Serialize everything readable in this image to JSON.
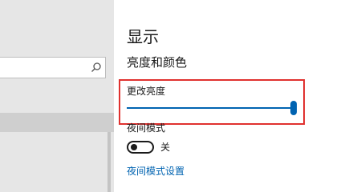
{
  "colors": {
    "accent": "#0063b1",
    "highlight_border": "#e0312f",
    "left_pane_bg": "#e6e6e6",
    "text": "#1a1a1a"
  },
  "search": {
    "value": "",
    "placeholder": "",
    "icon": "search-icon"
  },
  "page": {
    "title": "显示",
    "section_heading": "亮度和颜色"
  },
  "brightness": {
    "label": "更改亮度",
    "value_percent": 100
  },
  "night_mode": {
    "label": "夜间模式",
    "toggle_state_text": "关",
    "is_on": false,
    "settings_link": "夜间模式设置"
  }
}
